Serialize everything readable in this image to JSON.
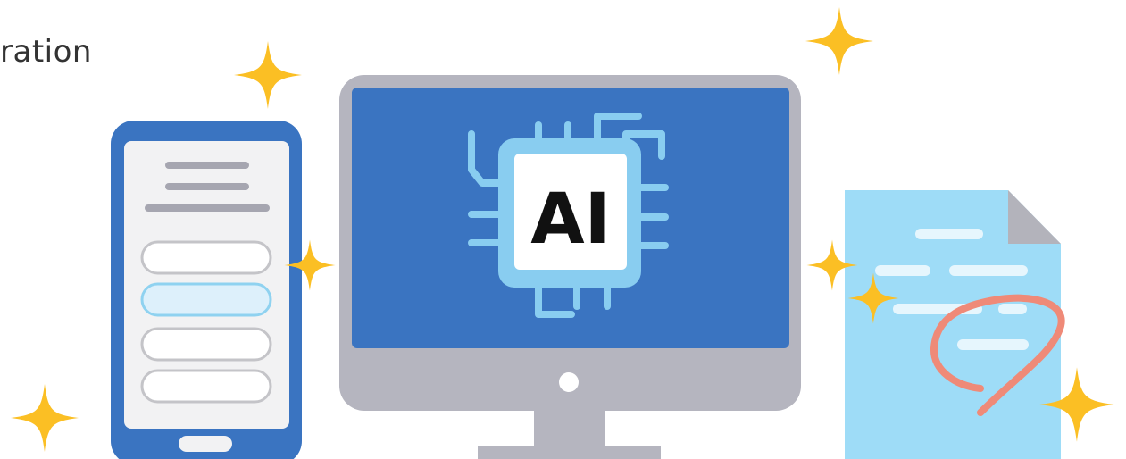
{
  "heading": {
    "text": "ration"
  },
  "monitor": {
    "chip_label": "AI"
  },
  "icons": {
    "phone": "smartphone-form-icon",
    "monitor": "monitor-icon",
    "chip": "ai-chip-icon",
    "document": "document-icon",
    "sparkle": "sparkle-icon",
    "annotation": "red-circle-annotation-icon"
  },
  "colors": {
    "phone_body": "#3a74c1",
    "phone_screen": "#f2f2f3",
    "monitor_frame": "#b5b5bf",
    "monitor_screen": "#3a74c1",
    "chip_outer": "#89cdf0",
    "chip_inner": "#ffffff",
    "chip_text": "#111111",
    "document": "#9edcf7",
    "document_fold": "#b3b3bb",
    "annotation": "#ef8a78",
    "sparkle": "#fbbf24"
  }
}
